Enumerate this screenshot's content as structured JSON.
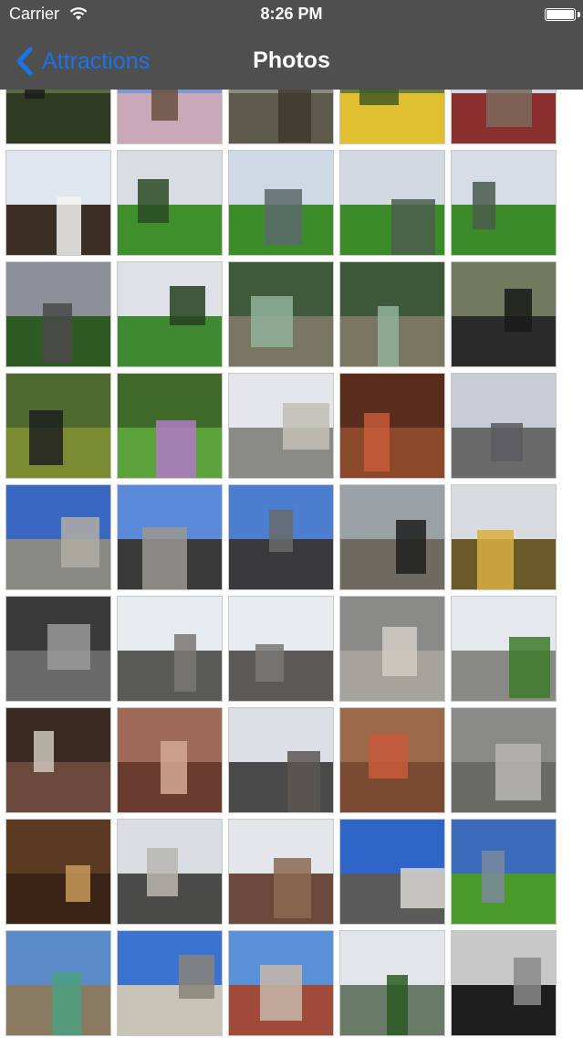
{
  "status_bar": {
    "carrier": "Carrier",
    "time": "8:26 PM"
  },
  "nav_bar": {
    "back_label": "Attractions",
    "title": "Photos"
  },
  "colors": {
    "bar_background": "#4f4f4f",
    "back_tint": "#1a73e8",
    "grid_background": "#ffffff"
  },
  "photos": [
    {
      "name": "photo-tree-trunk",
      "sky": "#5a6b3f",
      "ground": "#2f3a22",
      "accent": "#1c1c1c"
    },
    {
      "name": "photo-blossom-branches",
      "sky": "#7b9ad0",
      "ground": "#c9a9b8",
      "accent": "#6a5040"
    },
    {
      "name": "photo-tree-bark",
      "sky": "#8a8a7e",
      "ground": "#5d5a4d",
      "accent": "#3e3a30"
    },
    {
      "name": "photo-daffodils",
      "sky": "#6a7a3a",
      "ground": "#e0c030",
      "accent": "#3f5a22"
    },
    {
      "name": "photo-bare-tree",
      "sky": "#cfd6e2",
      "ground": "#8a2e2e",
      "accent": "#7a6a5a"
    },
    {
      "name": "photo-blossom-sky",
      "sky": "#dfe6f0",
      "ground": "#3b2f25",
      "accent": "#f2f2f2"
    },
    {
      "name": "photo-park-treeline",
      "sky": "#d8dde4",
      "ground": "#3f8f2d",
      "accent": "#2a4a22"
    },
    {
      "name": "photo-park-green",
      "sky": "#cfd8e4",
      "ground": "#3c8c2a",
      "accent": "#5a6a6a"
    },
    {
      "name": "photo-park-cross",
      "sky": "#d3d9e1",
      "ground": "#3a8a2a",
      "accent": "#4d5d4d"
    },
    {
      "name": "photo-park-open",
      "sky": "#d6dde6",
      "ground": "#3b8b2b",
      "accent": "#4a5a4a"
    },
    {
      "name": "photo-cloudy-cross",
      "sky": "#8c9098",
      "ground": "#2f5a24",
      "accent": "#4a4a4a"
    },
    {
      "name": "photo-park-path",
      "sky": "#dde2e8",
      "ground": "#3f8a30",
      "accent": "#24401c"
    },
    {
      "name": "photo-statue-rock",
      "sky": "#3e5a3a",
      "ground": "#7a7664",
      "accent": "#8fb39a"
    },
    {
      "name": "photo-statue-rock-2",
      "sky": "#3d593a",
      "ground": "#7a7662",
      "accent": "#8fb39a"
    },
    {
      "name": "photo-iron-gate",
      "sky": "#6f7a5e",
      "ground": "#2b2b2b",
      "accent": "#1a1a1a"
    },
    {
      "name": "photo-person-garden",
      "sky": "#4e6a2e",
      "ground": "#7a8a30",
      "accent": "#1e1e1e"
    },
    {
      "name": "photo-flower-beds",
      "sky": "#3f6a2a",
      "ground": "#5aa33a",
      "accent": "#b07ac6"
    },
    {
      "name": "photo-trinity-college",
      "sky": "#e4e6ea",
      "ground": "#8b8b86",
      "accent": "#c2c0b6"
    },
    {
      "name": "photo-stained-glass",
      "sky": "#5a2c1e",
      "ground": "#8a4a2a",
      "accent": "#c85a3a"
    },
    {
      "name": "photo-gothic-building",
      "sky": "#c8ccd4",
      "ground": "#6a6a6a",
      "accent": "#5a5a60"
    },
    {
      "name": "photo-building-blue-sky",
      "sky": "#3a68c0",
      "ground": "#8a8a84",
      "accent": "#b0ada4"
    },
    {
      "name": "photo-long-building",
      "sky": "#5a8ad8",
      "ground": "#3a3a3a",
      "accent": "#9a9890"
    },
    {
      "name": "photo-curved-building",
      "sky": "#4c7ed0",
      "ground": "#3a3a3c",
      "accent": "#6a6a68"
    },
    {
      "name": "photo-gate-steps",
      "sky": "#9aa2a8",
      "ground": "#6e6a62",
      "accent": "#1e1e1e"
    },
    {
      "name": "photo-rotunda",
      "sky": "#d8dce0",
      "ground": "#6a5a2a",
      "accent": "#d8b040"
    },
    {
      "name": "photo-cathedral-interior-bw",
      "sky": "#3a3a3a",
      "ground": "#6a6a6a",
      "accent": "#9a9a9a"
    },
    {
      "name": "photo-cathedral-tower",
      "sky": "#e8ecef",
      "ground": "#5a5a58",
      "accent": "#7a7874"
    },
    {
      "name": "photo-cathedral-tower-2",
      "sky": "#e9ecef",
      "ground": "#5b5a58",
      "accent": "#7a7874"
    },
    {
      "name": "photo-stone-ruins",
      "sky": "#8a8a88",
      "ground": "#a6a39c",
      "accent": "#cfccc4"
    },
    {
      "name": "photo-garden-path",
      "sky": "#e4e8ec",
      "ground": "#8a8a84",
      "accent": "#3d7a2a"
    },
    {
      "name": "photo-person-crypt",
      "sky": "#3a2a22",
      "ground": "#6a4a3a",
      "accent": "#cfc6b8"
    },
    {
      "name": "photo-vaulted-nave",
      "sky": "#a06a58",
      "ground": "#6a3c30",
      "accent": "#d2a894"
    },
    {
      "name": "photo-cathedral-exterior",
      "sky": "#dce0e6",
      "ground": "#4a4a4a",
      "accent": "#5a5654"
    },
    {
      "name": "photo-tomb-effigy",
      "sky": "#9a6a4a",
      "ground": "#7a4a32",
      "accent": "#c85a3a"
    },
    {
      "name": "photo-stone-plaque",
      "sky": "#8a8a88",
      "ground": "#6a6a66",
      "accent": "#b8b6b0"
    },
    {
      "name": "photo-dome-interior",
      "sky": "#5a3a20",
      "ground": "#3a2214",
      "accent": "#c89a5a"
    },
    {
      "name": "photo-columned-building",
      "sky": "#d9dde2",
      "ground": "#4a4a48",
      "accent": "#b8b6ae"
    },
    {
      "name": "photo-clocktower-building",
      "sky": "#e4e6ea",
      "ground": "#6a4a3a",
      "accent": "#8a6a52"
    },
    {
      "name": "photo-castle-tower",
      "sky": "#2f64c8",
      "ground": "#5a5a5a",
      "accent": "#d8d6d0"
    },
    {
      "name": "photo-castle-lawn",
      "sky": "#3a6ab8",
      "ground": "#4a9a2a",
      "accent": "#7a8a9a"
    },
    {
      "name": "photo-copper-dome-tower",
      "sky": "#5a8ac8",
      "ground": "#8a7a62",
      "accent": "#4aa080"
    },
    {
      "name": "photo-clock-tower-blue",
      "sky": "#3a74d0",
      "ground": "#c8c4b8",
      "accent": "#8a8478"
    },
    {
      "name": "photo-brick-gateway",
      "sky": "#5a90d8",
      "ground": "#a04a3a",
      "accent": "#c8b8a8"
    },
    {
      "name": "photo-tree-avenue",
      "sky": "#e2e6ea",
      "ground": "#6a7a6a",
      "accent": "#2a5a22"
    },
    {
      "name": "photo-bw-waterfront",
      "sky": "#c8c8c8",
      "ground": "#1e1e1e",
      "accent": "#8a8a8a"
    }
  ]
}
